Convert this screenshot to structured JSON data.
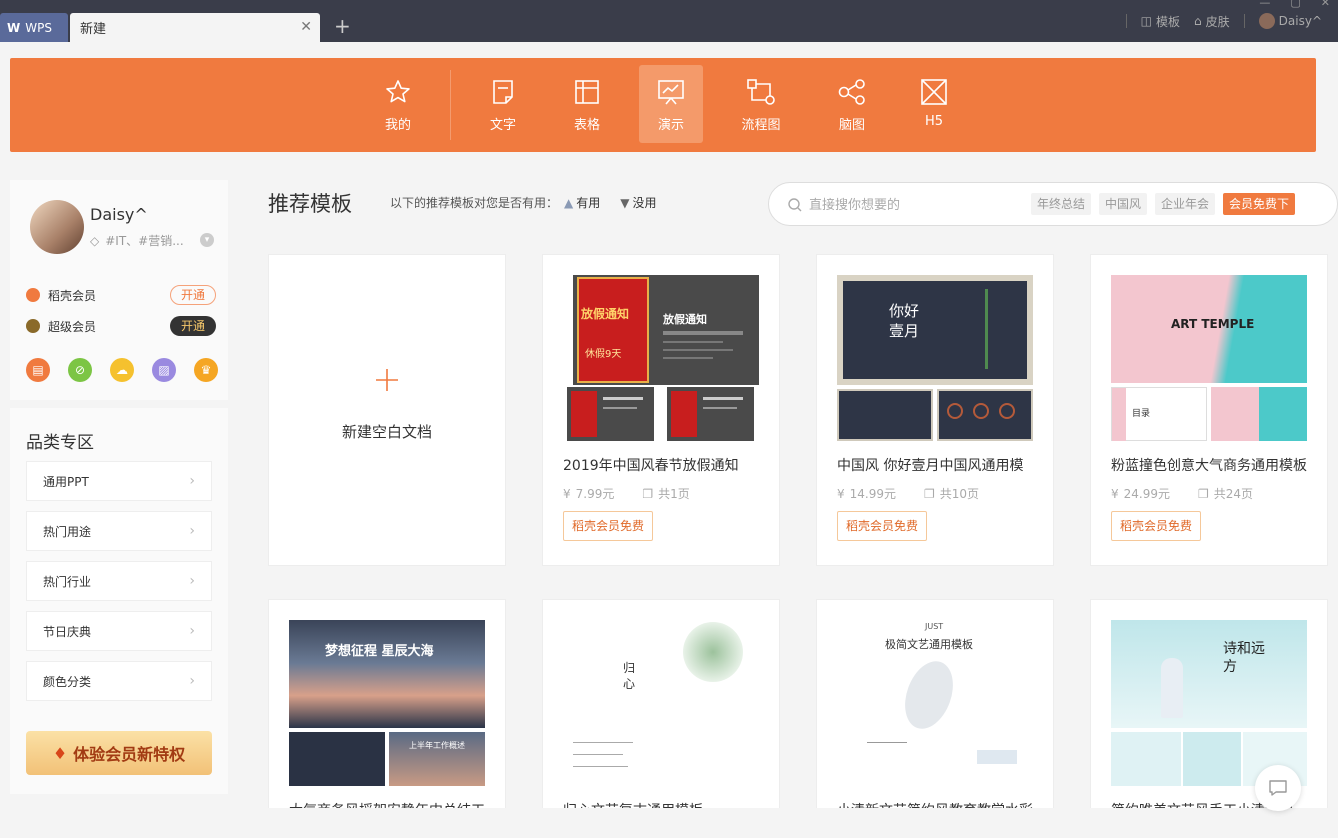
{
  "titlebar": {
    "app_tab": "WPS",
    "active_tab": "新建",
    "template_link": "模板",
    "skin_link": "皮肤",
    "user": "Daisy^"
  },
  "nav": {
    "items": [
      {
        "label": "我的",
        "icon": "star-icon"
      },
      {
        "label": "文字",
        "icon": "document-icon"
      },
      {
        "label": "表格",
        "icon": "table-icon"
      },
      {
        "label": "演示",
        "icon": "presentation-icon",
        "active": true
      },
      {
        "label": "流程图",
        "icon": "flowchart-icon"
      },
      {
        "label": "脑图",
        "icon": "mindmap-icon"
      },
      {
        "label": "H5",
        "icon": "h5-icon"
      }
    ]
  },
  "sidebar": {
    "username": "Daisy^",
    "tags": "#IT、#营销...",
    "memberships": [
      {
        "label": "稻壳会员",
        "button": "开通"
      },
      {
        "label": "超级会员",
        "button": "开通"
      }
    ],
    "category_title": "品类专区",
    "categories": [
      "通用PPT",
      "热门用途",
      "热门行业",
      "节日庆典",
      "颜色分类"
    ],
    "vip_button": "体验会员新特权"
  },
  "main": {
    "title": "推荐模板",
    "feedback_prompt": "以下的推荐模板对您是否有用：",
    "feedback_yes": "有用",
    "feedback_no": "没用",
    "search_placeholder": "直接搜你想要的",
    "search_tags": [
      "年终总结",
      "中国风",
      "企业年会",
      "会员免费下"
    ]
  },
  "blank_card": {
    "label": "新建空白文档"
  },
  "cards": [
    {
      "title": "2019年中国风春节放假通知",
      "price": "7.99元",
      "pages": "共1页",
      "badge": "稻壳会员免费",
      "thumb_text": {
        "main": "放假通知",
        "sub": "休假9天",
        "side": "放假通知"
      }
    },
    {
      "title": "中国风 你好壹月中国风通用模",
      "price": "14.99元",
      "pages": "共10页",
      "badge": "稻壳会员免费",
      "thumb_text": {
        "main": "你好壹月"
      }
    },
    {
      "title": "粉蓝撞色创意大气商务通用模板",
      "price": "24.99元",
      "pages": "共24页",
      "badge": "稻壳会员免费",
      "thumb_text": {
        "main": "ART TEMPLE",
        "sub": "目录"
      }
    }
  ],
  "row2": [
    {
      "title": "大气商务风摇架安静年中总结工",
      "thumb_text": {
        "main": "梦想征程 星辰大海",
        "sub": "上半年工作概述"
      }
    },
    {
      "title": "归心文艺复古通用模板",
      "thumb_text": {
        "main": "归心"
      }
    },
    {
      "title": "小清新文艺简约风教育教学水彩",
      "thumb_text": {
        "main": "极简文艺通用模板",
        "sub": "JUST"
      }
    },
    {
      "title": "简约唯美文艺风手工小清新通",
      "thumb_text": {
        "main": "诗和远方"
      }
    }
  ]
}
